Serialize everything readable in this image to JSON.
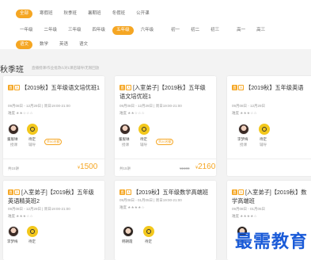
{
  "filters": {
    "row1": [
      "全部",
      "寒假班",
      "秋季班",
      "暑期班",
      "冬假班",
      "公开课"
    ],
    "row2": [
      "一年级",
      "二年级",
      "三年级",
      "四年级",
      "五年级",
      "六年级",
      "初一",
      "初二",
      "初三",
      "高一",
      "高三"
    ],
    "row3": [
      "语文",
      "数学",
      "英语",
      "语文"
    ],
    "accent": "#f5a623"
  },
  "section": {
    "title": "秋季班",
    "subtitle": "直播授课/作业批改/1对1课后辅导/无限回放"
  },
  "cards": [
    {
      "title": "【2019秋】五年级语文培优班1",
      "date": "09月08日 - 12月29日 | 周日19:00-21:00",
      "rating": "难度",
      "stars": "★★☆☆☆",
      "teacher": "董舰琳",
      "teacher_role": "授课",
      "assistant": "待定",
      "assistant_role": "辅导",
      "hot": "余50名额",
      "count": "共15讲",
      "original_price": "",
      "price": "1500"
    },
    {
      "title": "[入室弟子]【2019秋】五年级语文培优班1",
      "date": "09月08日 - 12月29日 | 周日19:00-21:00",
      "rating": "难度",
      "stars": "★★☆☆☆",
      "teacher": "董舰琳",
      "teacher_role": "授课",
      "assistant": "待定",
      "assistant_role": "辅导",
      "hot": "余20名额",
      "count": "共15讲",
      "original_price": "¥2400",
      "price": "2160"
    },
    {
      "title": "【2019秋】五年级英语",
      "date": "09月08日 - 12月29日",
      "rating": "难度",
      "stars": "★★★☆☆",
      "teacher": "李梦梅",
      "teacher_role": "授课",
      "assistant": "待定",
      "assistant_role": "辅导",
      "hot": "",
      "count": "",
      "original_price": "",
      "price": ""
    },
    {
      "title": "[入室弟子]【2019秋】五年级英语精英班2",
      "date": "09月08日 - 12月29日 | 周日19:00-21:00",
      "rating": "难度",
      "stars": "★★★☆☆",
      "teacher": "李梦梅",
      "teacher_role": "授课",
      "assistant": "待定",
      "assistant_role": "辅导",
      "hot": "",
      "count": "",
      "original_price": "",
      "price": ""
    },
    {
      "title": "【2019秋】五年级数学高端班",
      "date": "09月08日 - 01月05日 | 周日19:00-21:00",
      "rating": "难度",
      "stars": "★★★★☆",
      "teacher": "韩朝霞",
      "teacher_role": "授课",
      "assistant": "待定",
      "assistant_role": "辅导",
      "hot": "",
      "count": "",
      "original_price": "",
      "price": ""
    },
    {
      "title": "[入室弟子]【2019秋】数学高端班",
      "date": "09月08日 - 01月05日",
      "rating": "难度",
      "stars": "★★★★☆",
      "teacher": "韩朝霞",
      "teacher_role": "授课",
      "assistant": "",
      "assistant_role": "",
      "hot": "",
      "count": "",
      "original_price": "",
      "price": ""
    }
  ],
  "tags": {
    "live": "直",
    "type": "入"
  },
  "currency": "¥",
  "watermark": "最需教育"
}
